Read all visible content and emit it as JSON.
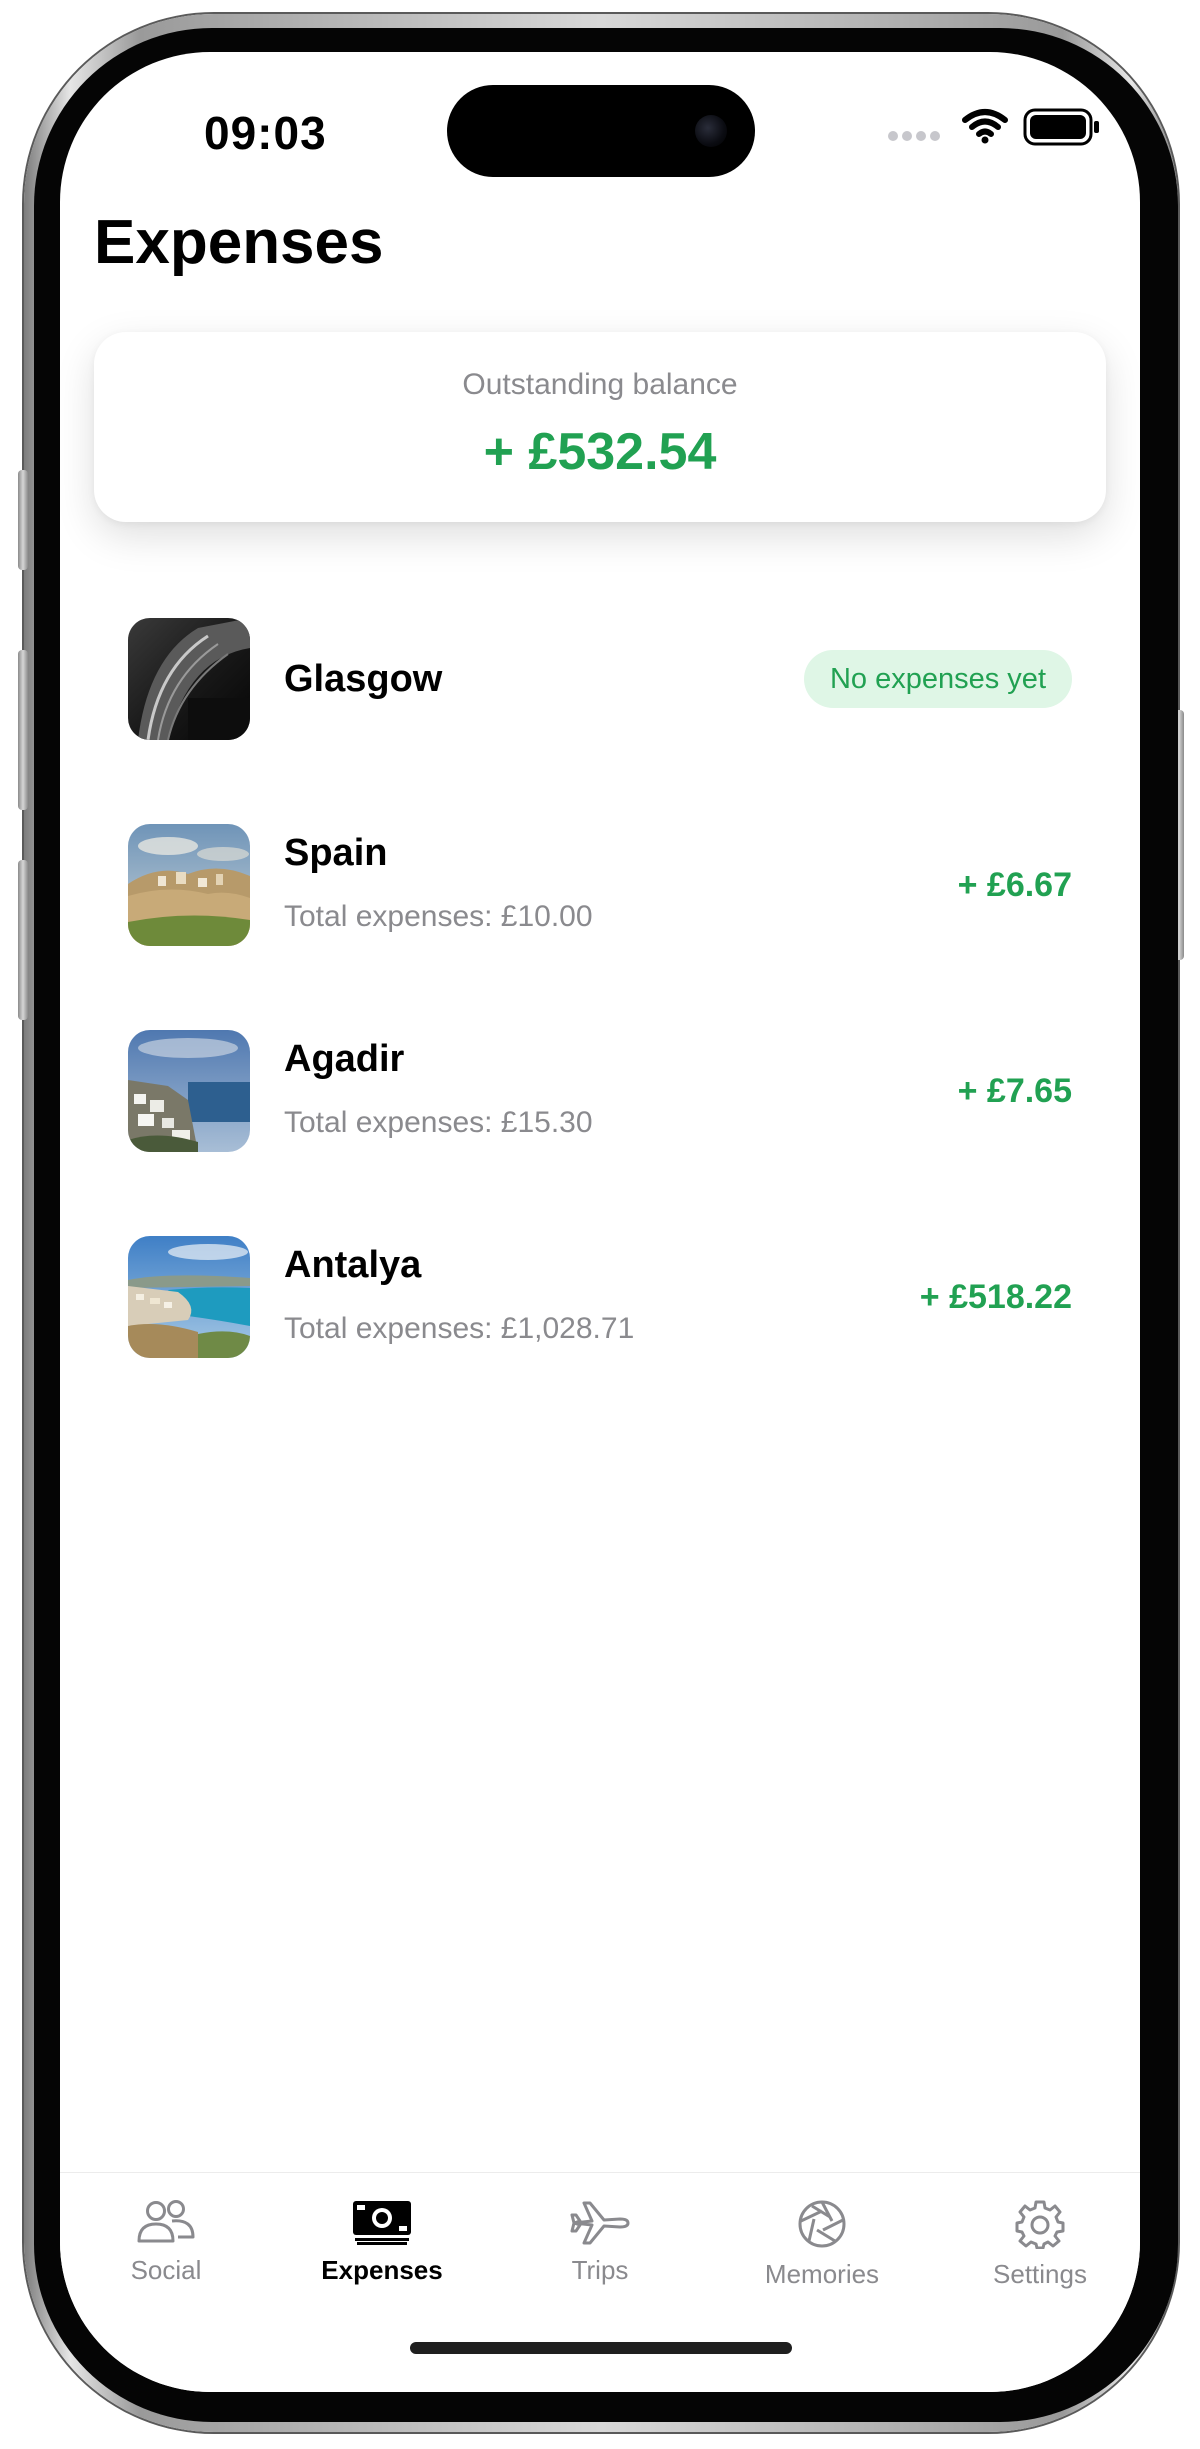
{
  "status_bar": {
    "time": "09:03"
  },
  "header": {
    "title": "Expenses"
  },
  "balance": {
    "label": "Outstanding balance",
    "amount": "+ £532.54"
  },
  "trips": [
    {
      "name": "Glasgow",
      "subtitle": "",
      "badge": "No expenses yet",
      "amount": "",
      "image": "dark-stadium-architecture"
    },
    {
      "name": "Spain",
      "subtitle": "Total expenses: £10.00",
      "badge": "",
      "amount": "+ £6.67",
      "image": "hillside-town"
    },
    {
      "name": "Agadir",
      "subtitle": "Total expenses: £15.30",
      "badge": "",
      "amount": "+ £7.65",
      "image": "coastal-white-town"
    },
    {
      "name": "Antalya",
      "subtitle": "Total expenses: £1,028.71",
      "badge": "",
      "amount": "+ £518.22",
      "image": "turquoise-bay"
    }
  ],
  "tab_bar": {
    "tabs": [
      {
        "label": "Social",
        "icon": "people-icon",
        "active": false
      },
      {
        "label": "Expenses",
        "icon": "banknote-icon",
        "active": true
      },
      {
        "label": "Trips",
        "icon": "airplane-icon",
        "active": false
      },
      {
        "label": "Memories",
        "icon": "aperture-icon",
        "active": false
      },
      {
        "label": "Settings",
        "icon": "gear-icon",
        "active": false
      }
    ]
  },
  "colors": {
    "positive": "#21a152",
    "badge_bg": "#dff6e6",
    "secondary_text": "#8a8a8e"
  }
}
